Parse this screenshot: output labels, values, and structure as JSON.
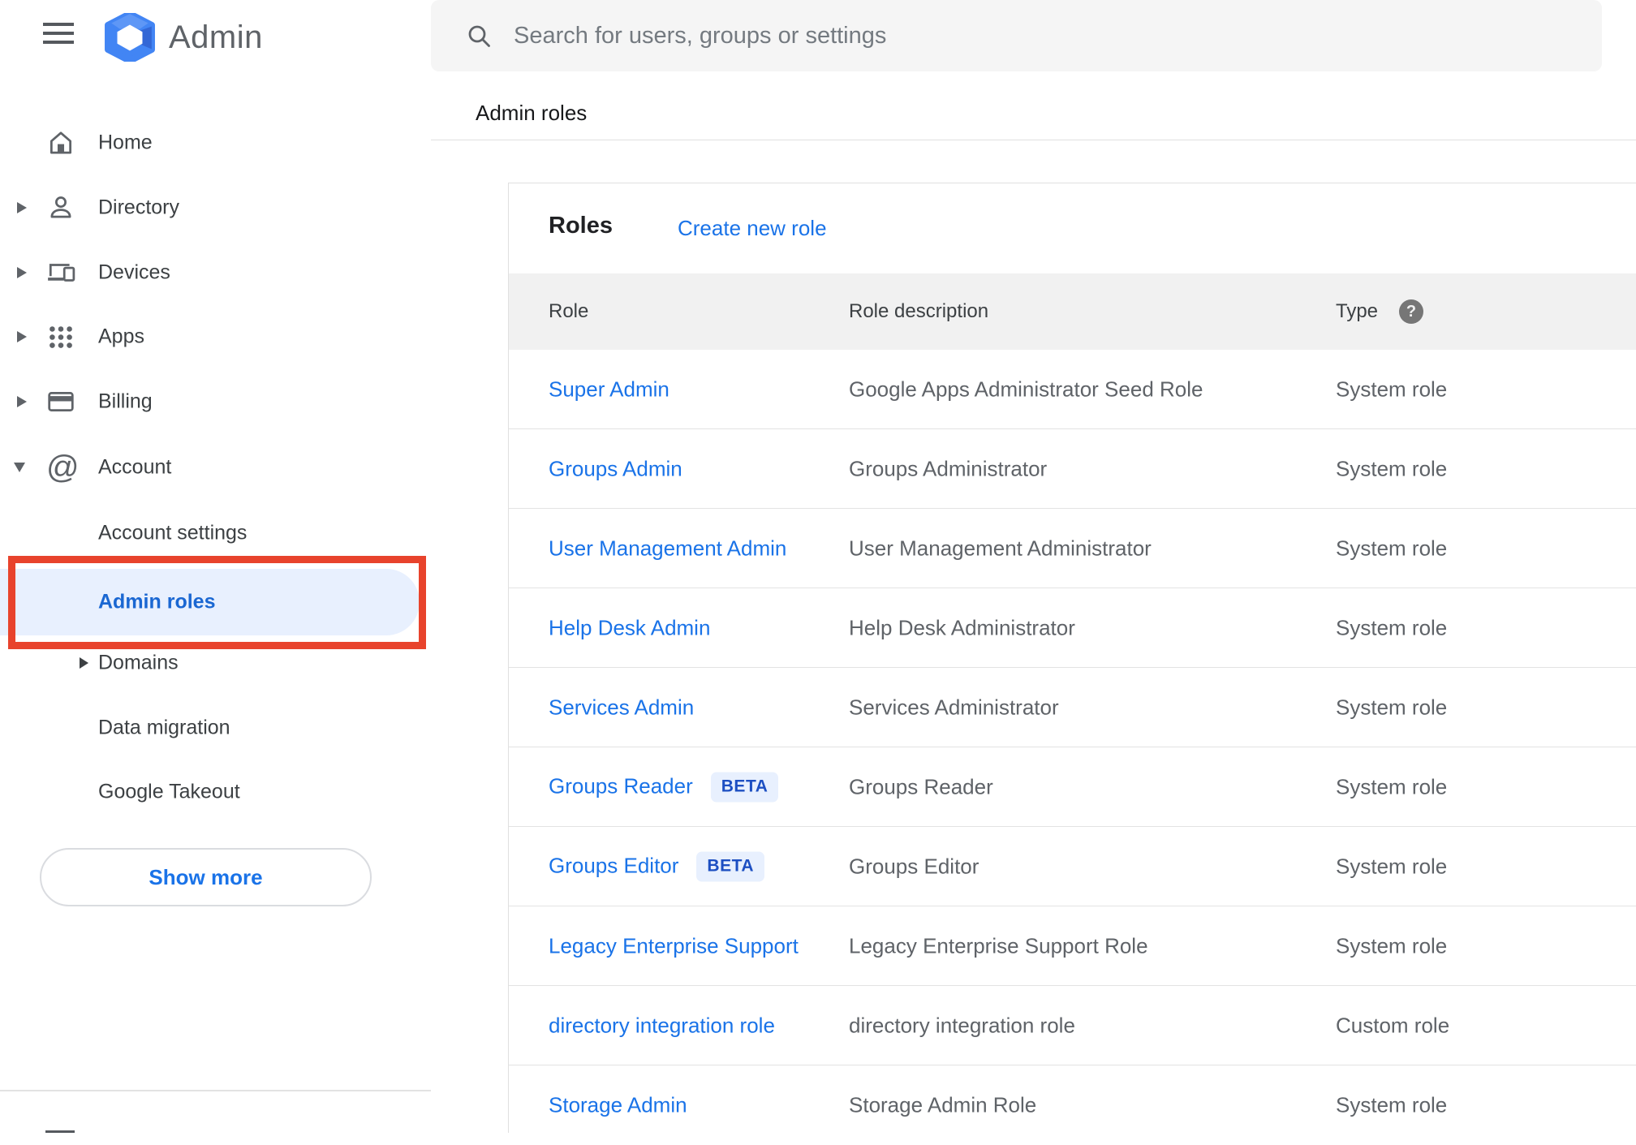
{
  "header": {
    "product_name": "Admin",
    "search_placeholder": "Search for users, groups or settings",
    "breadcrumb": "Admin roles"
  },
  "sidebar": {
    "items": [
      {
        "label": "Home",
        "icon": "home-icon",
        "expandable": false
      },
      {
        "label": "Directory",
        "icon": "person-icon",
        "expandable": true,
        "state": "collapsed"
      },
      {
        "label": "Devices",
        "icon": "devices-icon",
        "expandable": true,
        "state": "collapsed"
      },
      {
        "label": "Apps",
        "icon": "apps-grid-icon",
        "expandable": true,
        "state": "collapsed"
      },
      {
        "label": "Billing",
        "icon": "credit-card-icon",
        "expandable": true,
        "state": "collapsed"
      },
      {
        "label": "Account",
        "icon": "at-sign-icon",
        "expandable": true,
        "state": "expanded"
      }
    ],
    "account_submenu": [
      {
        "label": "Account settings"
      },
      {
        "label": "Admin roles",
        "active": true
      },
      {
        "label": "Domains",
        "expandable": true,
        "state": "collapsed"
      },
      {
        "label": "Data migration"
      },
      {
        "label": "Google Takeout"
      }
    ],
    "show_more_label": "Show more",
    "active_item": "Admin roles"
  },
  "annotation": {
    "type": "red-highlight-box",
    "target": "Admin roles sidebar item",
    "color": "#e8432c"
  },
  "main": {
    "roles_title": "Roles",
    "create_new_role_label": "Create new role",
    "table": {
      "columns": [
        "Role",
        "Role description",
        "Type"
      ],
      "type_help_icon": "question-mark-help-icon",
      "rows": [
        {
          "role": "Super Admin",
          "description": "Google Apps Administrator Seed Role",
          "type": "System role"
        },
        {
          "role": "Groups Admin",
          "description": "Groups Administrator",
          "type": "System role"
        },
        {
          "role": "User Management Admin",
          "description": "User Management Administrator",
          "type": "System role"
        },
        {
          "role": "Help Desk Admin",
          "description": "Help Desk Administrator",
          "type": "System role"
        },
        {
          "role": "Services Admin",
          "description": "Services Administrator",
          "type": "System role"
        },
        {
          "role": "Groups Reader",
          "badge": "BETA",
          "description": "Groups Reader",
          "type": "System role"
        },
        {
          "role": "Groups Editor",
          "badge": "BETA",
          "description": "Groups Editor",
          "type": "System role"
        },
        {
          "role": "Legacy Enterprise Support",
          "description": "Legacy Enterprise Support Role",
          "type": "System role"
        },
        {
          "role": "directory integration role",
          "description": "directory integration role",
          "type": "Custom role"
        },
        {
          "role": "Storage Admin",
          "description": "Storage Admin Role",
          "type": "System role"
        }
      ]
    }
  },
  "colors": {
    "link_blue": "#1a73e8",
    "active_pill_bg": "#e8f0fe",
    "active_text": "#1a67d2",
    "annotation_red": "#e8432c",
    "table_header_bg": "#f1f1f1",
    "badge_bg": "#e8f0fe",
    "badge_text": "#1d4fc2"
  }
}
